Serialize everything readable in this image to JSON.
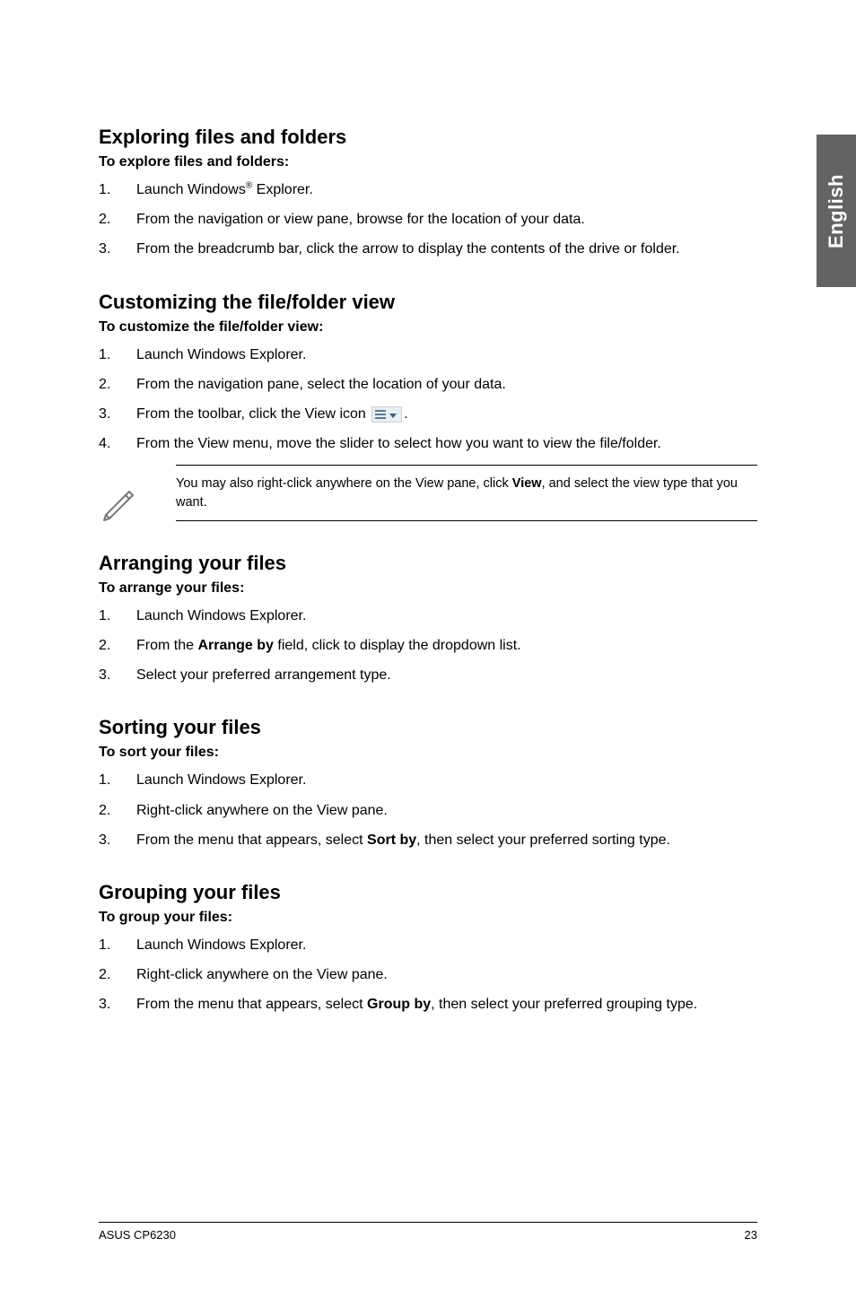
{
  "side_tab": "English",
  "sections": {
    "exploring": {
      "heading": "Exploring files and folders",
      "sub": "To explore files and folders:",
      "items": [
        {
          "n": "1.",
          "pre": "Launch Windows",
          "sup": "®",
          "post": " Explorer."
        },
        {
          "n": "2.",
          "text": "From the navigation or view pane, browse for the location of your data."
        },
        {
          "n": "3.",
          "text": "From the breadcrumb bar, click the arrow to display the contents of the drive or folder."
        }
      ]
    },
    "customizing": {
      "heading": "Customizing the file/folder view",
      "sub": "To customize the file/folder view:",
      "items": [
        {
          "n": "1.",
          "text": "Launch Windows Explorer."
        },
        {
          "n": "2.",
          "text": "From the navigation pane, select the location of your data."
        },
        {
          "n": "3.",
          "pre": "From the toolbar, click the View icon ",
          "icon": true,
          "post": "."
        },
        {
          "n": "4.",
          "text": "From the View menu, move the slider to select how you want to view the file/folder."
        }
      ],
      "note_pre": "You may also right-click anywhere on the View pane, click ",
      "note_bold": "View",
      "note_post": ", and select the view type that you want."
    },
    "arranging": {
      "heading": "Arranging your files",
      "sub": "To arrange your files:",
      "items": [
        {
          "n": "1.",
          "text": "Launch Windows Explorer."
        },
        {
          "n": "2.",
          "pre": "From the ",
          "bold": "Arrange by",
          "post": " field, click to display the dropdown list."
        },
        {
          "n": "3.",
          "text": "Select your preferred arrangement type."
        }
      ]
    },
    "sorting": {
      "heading": "Sorting your files",
      "sub": "To sort your files:",
      "items": [
        {
          "n": "1.",
          "text": "Launch Windows Explorer."
        },
        {
          "n": "2.",
          "text": "Right-click anywhere on the View pane."
        },
        {
          "n": "3.",
          "pre": "From the menu that appears, select ",
          "bold": "Sort by",
          "post": ", then select your preferred sorting type."
        }
      ]
    },
    "grouping": {
      "heading": "Grouping your files",
      "sub": "To group your files:",
      "items": [
        {
          "n": "1.",
          "text": "Launch Windows Explorer."
        },
        {
          "n": "2.",
          "text": "Right-click anywhere on the View pane."
        },
        {
          "n": "3.",
          "pre": "From the menu that appears, select ",
          "bold": "Group by",
          "post": ", then select your preferred grouping type."
        }
      ]
    }
  },
  "footer": {
    "left": "ASUS CP6230",
    "right": "23"
  }
}
